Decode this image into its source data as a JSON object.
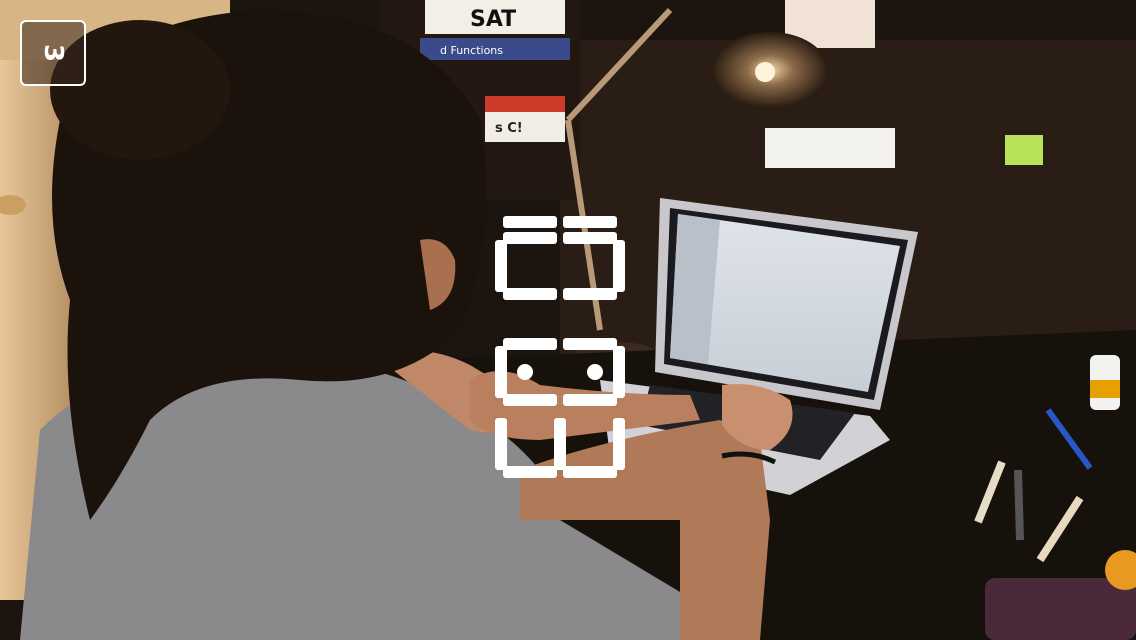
{
  "countdown_badge": {
    "value": "3"
  },
  "clock_overlay": {
    "time": "10:03",
    "orientation": "rotated-90"
  },
  "photo": {
    "scene_text": {
      "book_spine_1": "SAT",
      "book_spine_2": "d Functions",
      "book_spine_3": "s C!"
    }
  },
  "colors": {
    "overlay_text": "#ffffff",
    "badge_border": "#ffffff"
  }
}
